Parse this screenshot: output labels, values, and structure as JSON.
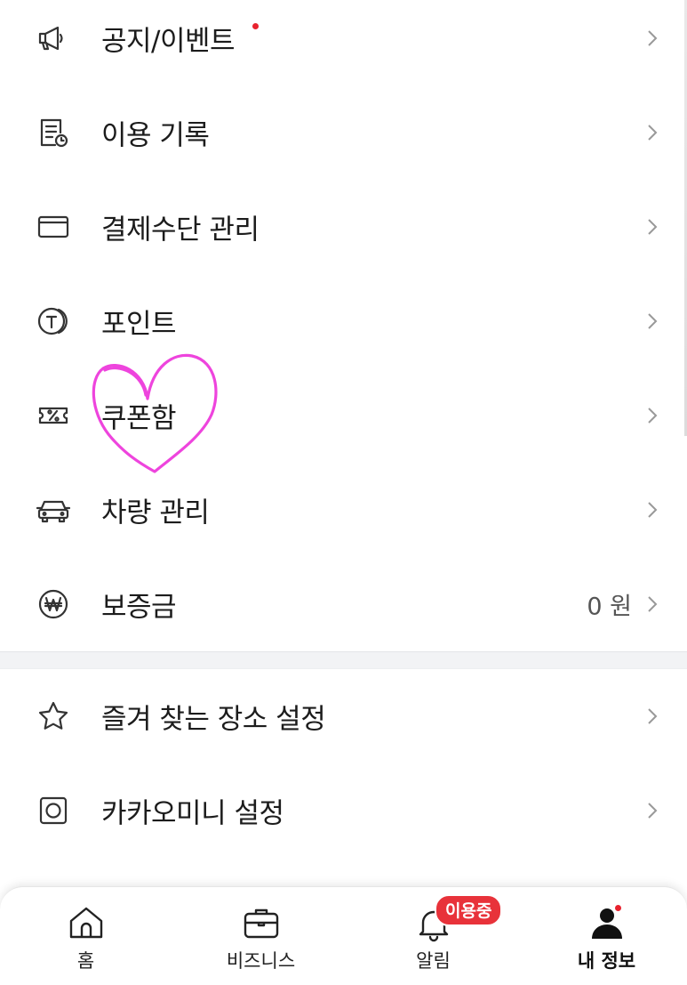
{
  "menu_group_1": [
    {
      "label": "공지/이벤트",
      "icon": "megaphone-icon",
      "has_dot": true
    },
    {
      "label": "이용 기록",
      "icon": "receipt-clock-icon"
    },
    {
      "label": "결제수단 관리",
      "icon": "card-icon"
    },
    {
      "label": "포인트",
      "icon": "point-coin-icon"
    },
    {
      "label": "쿠폰함",
      "icon": "coupon-icon"
    },
    {
      "label": "차량 관리",
      "icon": "car-icon"
    },
    {
      "label": "보증금",
      "icon": "won-coin-icon",
      "value": "0 원"
    }
  ],
  "menu_group_2": [
    {
      "label": "즐겨 찾는 장소 설정",
      "icon": "star-icon"
    },
    {
      "label": "카카오미니 설정",
      "icon": "kakao-mini-icon"
    }
  ],
  "tabbar": {
    "tabs": [
      {
        "label": "홈",
        "icon": "home-icon"
      },
      {
        "label": "비즈니스",
        "icon": "briefcase-icon"
      },
      {
        "label": "알림",
        "icon": "bell-icon",
        "badge": "이용중"
      },
      {
        "label": "내 정보",
        "icon": "person-icon",
        "active": true,
        "has_dot": true
      }
    ]
  },
  "colors": {
    "accent_red": "#e8222e",
    "badge_red": "#e8323a",
    "annotation_heart": "#ee44dd",
    "divider_bg": "#f2f3f5"
  }
}
